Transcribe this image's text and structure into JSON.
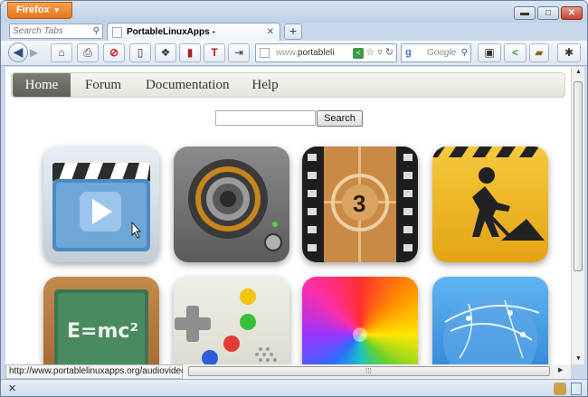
{
  "window": {
    "app_menu_label": "Firefox",
    "controls": {
      "minimize": "▬",
      "maximize": "□",
      "close": "✕"
    }
  },
  "tabs": {
    "search_placeholder": "Search Tabs",
    "active_tab_title": "PortableLinuxApps -",
    "new_tab_label": "+"
  },
  "navbar": {
    "url_visible": "portableli",
    "url_prefix": "www.",
    "search_engine_placeholder": "Google",
    "icons": [
      "back-arrow-icon",
      "forward-arrow-icon",
      "home-icon",
      "printer-icon",
      "stop-block-icon",
      "sidebar-icon",
      "reader-icon",
      "book-icon",
      "text-t-icon",
      "logout-icon",
      "share-icon",
      "bookmark-star-icon",
      "reload-icon",
      "screenshot-icon",
      "addon-icon"
    ]
  },
  "site": {
    "nav": [
      {
        "label": "Home",
        "active": true
      },
      {
        "label": "Forum",
        "active": false
      },
      {
        "label": "Documentation",
        "active": false
      },
      {
        "label": "Help",
        "active": false
      }
    ],
    "search_button": "Search",
    "search_value": "",
    "apps": [
      {
        "name": "video-player-icon"
      },
      {
        "name": "audio-speaker-icon"
      },
      {
        "name": "film-countdown-icon"
      },
      {
        "name": "construction-worker-icon"
      },
      {
        "name": "chalkboard-emc2-icon",
        "text": "E=mc²"
      },
      {
        "name": "gamepad-icon"
      },
      {
        "name": "color-pinwheel-icon"
      },
      {
        "name": "globe-network-icon"
      }
    ]
  },
  "status": {
    "hover_url": "http://www.portablelinuxapps.org/audiovideo",
    "close_label": "✕"
  }
}
